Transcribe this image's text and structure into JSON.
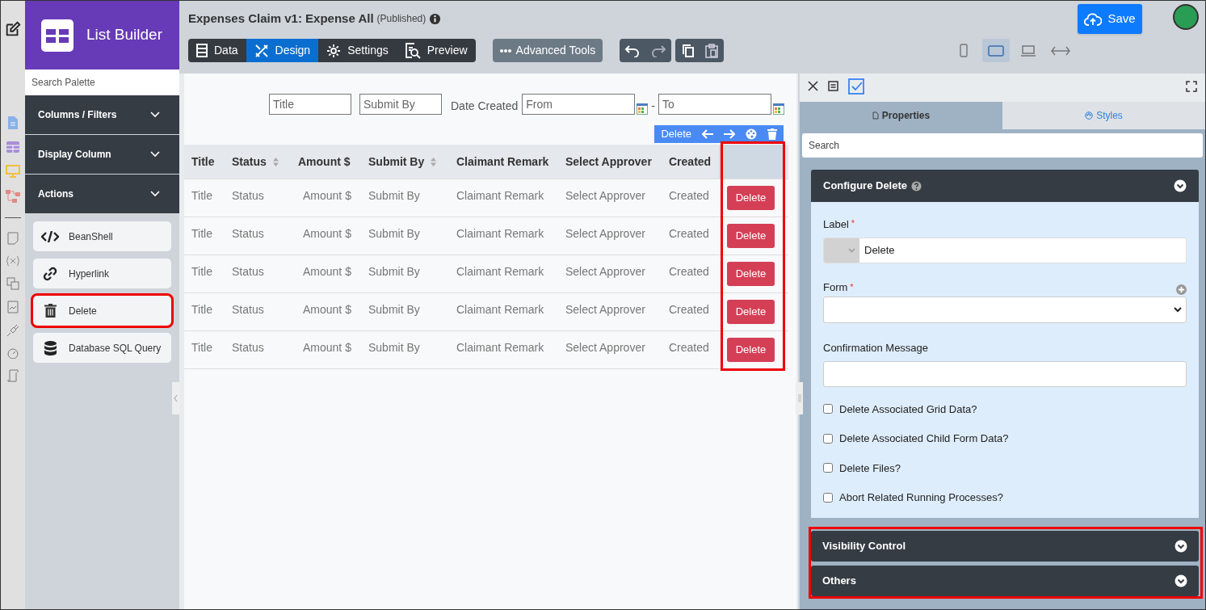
{
  "palette": {
    "title": "List Builder",
    "search_placeholder": "Search Palette",
    "sections": [
      {
        "label": "Columns / Filters"
      },
      {
        "label": "Display Column"
      },
      {
        "label": "Actions"
      }
    ],
    "actions": [
      {
        "kind": "code",
        "label": "BeanShell",
        "highlighted": false
      },
      {
        "kind": "link",
        "label": "Hyperlink",
        "highlighted": false
      },
      {
        "kind": "trash",
        "label": "Delete",
        "highlighted": true
      },
      {
        "kind": "database",
        "label": "Database SQL Query",
        "highlighted": false
      }
    ]
  },
  "header": {
    "title": "Expenses Claim v1: Expense All",
    "status": "(Published)"
  },
  "mode_tabs": [
    {
      "kind": "data",
      "label": "Data",
      "selected": false
    },
    {
      "kind": "design",
      "label": "Design",
      "selected": true
    },
    {
      "kind": "settings",
      "label": "Settings",
      "selected": false
    },
    {
      "kind": "preview",
      "label": "Preview",
      "selected": false
    }
  ],
  "advanced_tools": "Advanced Tools",
  "save": "Save",
  "device_views": [
    {
      "kind": "phone",
      "selected": false
    },
    {
      "kind": "tablet",
      "selected": true
    },
    {
      "kind": "laptop",
      "selected": false
    },
    {
      "kind": "full",
      "selected": false
    }
  ],
  "filters": {
    "title_placeholder": "Title",
    "submit_by_placeholder": "Submit By",
    "date_label": "Date Created",
    "from_placeholder": "From",
    "separator": "-",
    "to_placeholder": "To"
  },
  "column_toolbar": {
    "label": "Delete"
  },
  "table": {
    "columns": [
      {
        "label": "Title",
        "sortable": false
      },
      {
        "label": "Status",
        "sortable": true
      },
      {
        "label": "Amount $",
        "sortable": false
      },
      {
        "label": "Submit By",
        "sortable": true
      },
      {
        "label": "Claimant Remark",
        "sortable": false
      },
      {
        "label": "Select Approver",
        "sortable": false
      },
      {
        "label": "Created",
        "sortable": false
      }
    ],
    "action_highlighted": true,
    "rows": [
      {
        "cells": [
          "Title",
          "Status",
          "Amount $",
          "Submit By",
          "Claimant Remark",
          "Select Approver",
          "Created"
        ],
        "action": "Delete"
      },
      {
        "cells": [
          "Title",
          "Status",
          "Amount $",
          "Submit By",
          "Claimant Remark",
          "Select Approver",
          "Created"
        ],
        "action": "Delete"
      },
      {
        "cells": [
          "Title",
          "Status",
          "Amount $",
          "Submit By",
          "Claimant Remark",
          "Select Approver",
          "Created"
        ],
        "action": "Delete"
      },
      {
        "cells": [
          "Title",
          "Status",
          "Amount $",
          "Submit By",
          "Claimant Remark",
          "Select Approver",
          "Created"
        ],
        "action": "Delete"
      },
      {
        "cells": [
          "Title",
          "Status",
          "Amount $",
          "Submit By",
          "Claimant Remark",
          "Select Approver",
          "Created"
        ],
        "action": "Delete"
      }
    ]
  },
  "properties": {
    "tabs": [
      {
        "label": "Properties",
        "selected": true
      },
      {
        "label": "Styles",
        "selected": false
      }
    ],
    "search_placeholder": "Search",
    "configure": {
      "title": "Configure Delete",
      "label_field": {
        "label": "Label",
        "required": "*",
        "value": "Delete"
      },
      "form_field": {
        "label": "Form",
        "required": "*"
      },
      "confirmation_field": {
        "label": "Confirmation Message"
      },
      "checkboxes": [
        {
          "label": "Delete Associated Grid Data?",
          "checked": false
        },
        {
          "label": "Delete Associated Child Form Data?",
          "checked": false
        },
        {
          "label": "Delete Files?",
          "checked": false
        },
        {
          "label": "Abort Related Running Processes?",
          "checked": false
        }
      ]
    },
    "more_sections": [
      {
        "title": "Visibility Control"
      },
      {
        "title": "Others"
      }
    ],
    "more_highlighted": true
  }
}
